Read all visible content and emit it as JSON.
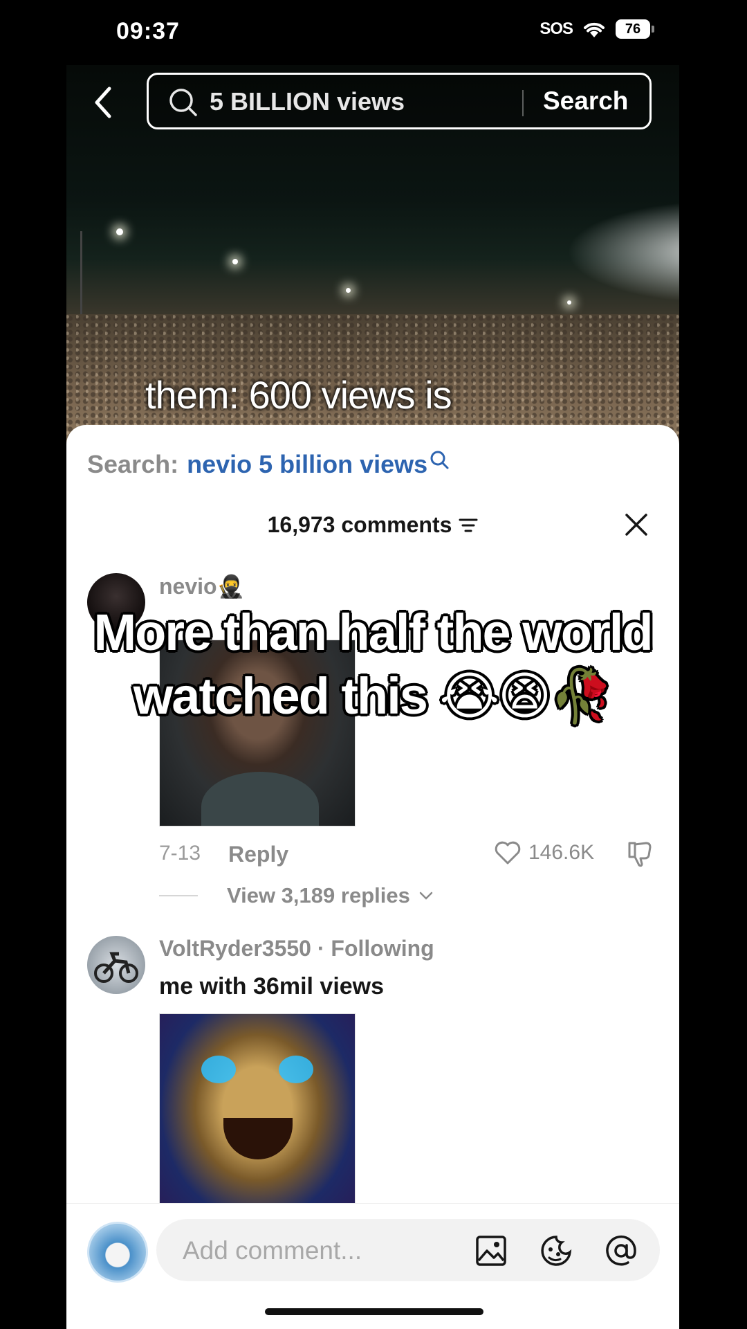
{
  "status_bar": {
    "time": "09:37",
    "sos": "SOS",
    "battery": "76"
  },
  "header": {
    "search_query": "5 BILLION views",
    "search_button": "Search"
  },
  "video": {
    "caption": "them: 600 views is"
  },
  "sheet": {
    "related_search_prefix": "Search:",
    "related_search_term": "nevio 5 billion views",
    "comment_count": "16,973 comments"
  },
  "comments": [
    {
      "username": "nevio🥷",
      "date": "7-13",
      "reply_label": "Reply",
      "likes": "146.6K",
      "view_replies": "View 3,189 replies"
    },
    {
      "username": "VoltRyder3550 · Following",
      "text": "me with 36mil views"
    }
  ],
  "overlay": {
    "line1": "More than half the world",
    "line2": "watched this 😭😫🥀"
  },
  "composer": {
    "placeholder": "Add comment..."
  },
  "colors": {
    "accent_link": "#2d64b0",
    "muted": "#8a8a8a",
    "text": "#161616"
  }
}
